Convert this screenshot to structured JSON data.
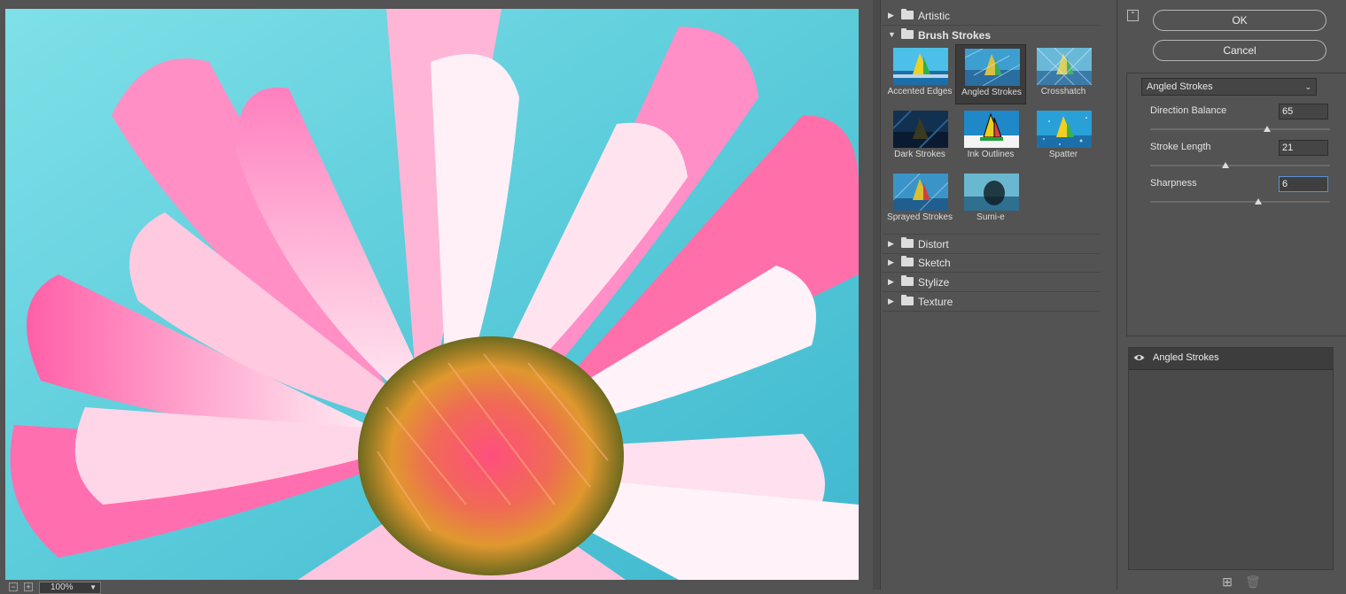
{
  "preview": {
    "zoom_level": "100%",
    "zoom_out_icon": "minus-square-icon",
    "zoom_in_icon": "plus-square-icon"
  },
  "gallery": {
    "categories_top": [
      {
        "label": "Artistic",
        "expanded": false
      }
    ],
    "open_category": {
      "label": "Brush Strokes",
      "expanded": true,
      "filters": [
        {
          "label": "Accented Edges",
          "selected": false
        },
        {
          "label": "Angled Strokes",
          "selected": true
        },
        {
          "label": "Crosshatch",
          "selected": false
        },
        {
          "label": "Dark Strokes",
          "selected": false
        },
        {
          "label": "Ink Outlines",
          "selected": false
        },
        {
          "label": "Spatter",
          "selected": false
        },
        {
          "label": "Sprayed Strokes",
          "selected": false
        },
        {
          "label": "Sumi-e",
          "selected": false
        }
      ]
    },
    "categories_bottom": [
      {
        "label": "Distort",
        "expanded": false
      },
      {
        "label": "Sketch",
        "expanded": false
      },
      {
        "label": "Stylize",
        "expanded": false
      },
      {
        "label": "Texture",
        "expanded": false
      }
    ]
  },
  "dialog": {
    "ok_label": "OK",
    "cancel_label": "Cancel",
    "filter_select_value": "Angled Strokes",
    "params": [
      {
        "label": "Direction Balance",
        "value": "65",
        "fraction": 0.65
      },
      {
        "label": "Stroke Length",
        "value": "21",
        "fraction": 0.42
      },
      {
        "label": "Sharpness",
        "value": "6",
        "fraction": 0.6,
        "active": true
      }
    ]
  },
  "layers": {
    "items": [
      {
        "name": "Angled Strokes",
        "visible": true
      }
    ],
    "new_layer_icon": "plus-square-icon",
    "delete_layer_icon": "trash-icon"
  },
  "colors": {
    "panel_bg": "#535353",
    "selection_border": "#5b8fd8"
  }
}
